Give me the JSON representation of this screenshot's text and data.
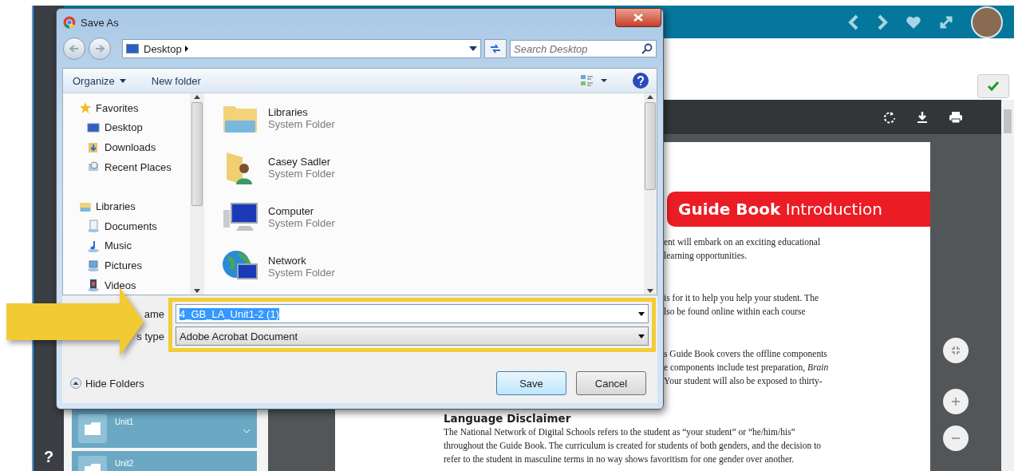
{
  "sidebar": {
    "units": [
      {
        "label": "Unit1"
      },
      {
        "label": "Unit2"
      }
    ],
    "help": "?"
  },
  "document": {
    "banner": "**Guide Book** Introduction",
    "fragments": [
      [
        "ent will embark on an exciting educational",
        "learning opportunities."
      ],
      [
        "is for it to help you help your student. The",
        "lso be found online within each course"
      ],
      [
        "s Guide Book covers the offline components",
        "e components include test preparation, *Brain*",
        "Your student will also be exposed to thirty-"
      ]
    ],
    "heading": "Language Disclaimer",
    "paragraph": "The National Network of Digital Schools refers to the student as “your student” or “he/him/his” throughout the Guide Book. The curriculum is created for students of both genders, and the decision to refer to the student in masculine terms in no way shows favoritism for one gender over another."
  },
  "dialog": {
    "title": "Save As",
    "address": "Desktop",
    "search_placeholder": "Search Desktop",
    "toolbar": [
      {
        "label": "Organize",
        "dropdown": true
      },
      {
        "label": "New folder",
        "dropdown": false
      }
    ],
    "nav": [
      {
        "label": "Favorites",
        "kind": "star",
        "children": [
          {
            "label": "Desktop",
            "kind": "desktop"
          },
          {
            "label": "Downloads",
            "kind": "download"
          },
          {
            "label": "Recent Places",
            "kind": "recent"
          }
        ]
      },
      {
        "label": "Libraries",
        "kind": "library",
        "children": [
          {
            "label": "Documents",
            "kind": "doc"
          },
          {
            "label": "Music",
            "kind": "music"
          },
          {
            "label": "Pictures",
            "kind": "picture"
          },
          {
            "label": "Videos",
            "kind": "video"
          }
        ]
      }
    ],
    "items": [
      {
        "name": "Libraries",
        "subtitle": "System Folder",
        "kind": "library"
      },
      {
        "name": "Casey Sadler",
        "subtitle": "System Folder",
        "kind": "user"
      },
      {
        "name": "Computer",
        "subtitle": "System Folder",
        "kind": "computer"
      },
      {
        "name": "Network",
        "subtitle": "System Folder",
        "kind": "network"
      }
    ],
    "file_name_label": "ame",
    "file_name": "4_GB_LA_Unit1-2 (1)",
    "save_type_label": "s type",
    "save_type": "Adobe Acrobat Document",
    "hide_folders": "Hide Folders",
    "buttons": [
      {
        "label": "Save",
        "default": true
      },
      {
        "label": "Cancel",
        "default": false
      }
    ]
  }
}
